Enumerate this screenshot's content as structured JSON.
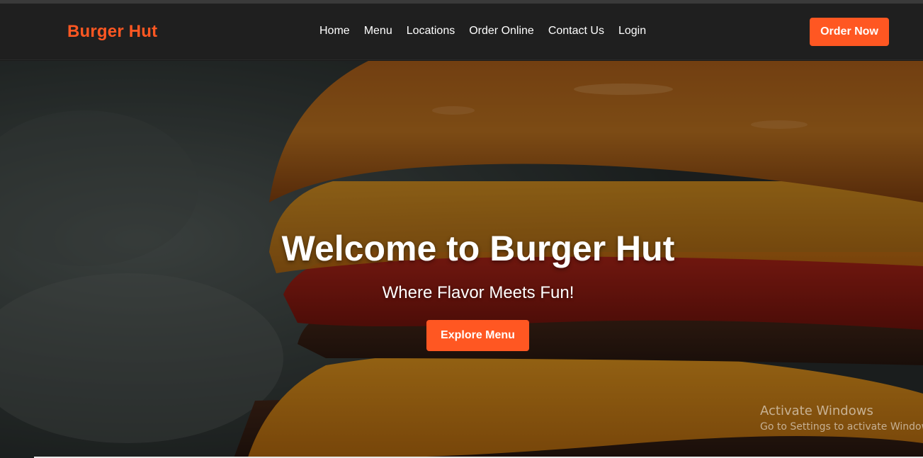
{
  "navbar": {
    "logo": "Burger Hut",
    "links": [
      "Home",
      "Menu",
      "Locations",
      "Order Online",
      "Contact Us",
      "Login"
    ],
    "order_button": "Order Now"
  },
  "hero": {
    "title": "Welcome to Burger Hut",
    "subtitle": "Where Flavor Meets Fun!",
    "cta_button": "Explore Menu",
    "background_image": "burger-close-up"
  },
  "os_watermark": {
    "title": "Activate Windows",
    "subtitle": "Go to Settings to activate Windows."
  },
  "colors": {
    "accent": "#ff5722",
    "navbar_bg": "#1f1f1f",
    "text": "#ffffff"
  }
}
